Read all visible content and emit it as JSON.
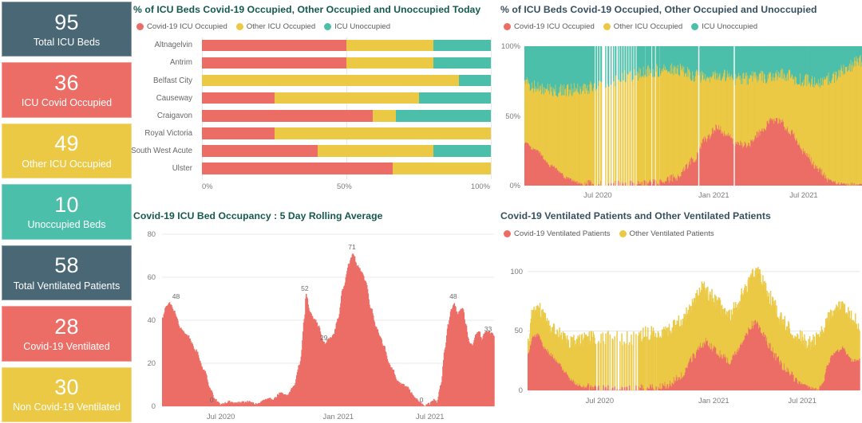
{
  "colors": {
    "covid_red": "#ec6d66",
    "other_yellow": "#ebc945",
    "unoccupied_teal": "#4cbfaa",
    "slate": "#4a6775",
    "title_green": "#14594f",
    "title_slate": "#36505e",
    "axis_text": "#7a7a7a",
    "grid": "#e8e8e8"
  },
  "kpis": [
    {
      "value": "95",
      "label": "Total ICU Beds",
      "color": "#4a6775",
      "name": "total-icu-beds"
    },
    {
      "value": "36",
      "label": "ICU Covid Occupied",
      "color": "#ec6d66",
      "name": "icu-covid-occupied"
    },
    {
      "value": "49",
      "label": "Other ICU Occupied",
      "color": "#ebc945",
      "name": "other-icu-occupied"
    },
    {
      "value": "10",
      "label": "Unoccupied Beds",
      "color": "#4cbfaa",
      "name": "unoccupied-beds"
    },
    {
      "value": "58",
      "label": "Total Ventilated Patients",
      "color": "#4a6775",
      "name": "total-ventilated-patients"
    },
    {
      "value": "28",
      "label": "Covid-19 Ventilated",
      "color": "#ec6d66",
      "name": "covid-19-ventilated"
    },
    {
      "value": "30",
      "label": "Non Covid-19 Ventilated",
      "color": "#ebc945",
      "name": "non-covid-19-ventilated"
    }
  ],
  "panel_top_left": {
    "title": "% of ICU Beds Covid-19 Occupied, Other Occupied and Unoccupied Today",
    "legend": [
      {
        "label": "Covid-19 ICU Occupied",
        "color": "#ec6d66"
      },
      {
        "label": "Other ICU Occupied",
        "color": "#ebc945"
      },
      {
        "label": "ICU Unoccupied",
        "color": "#4cbfaa"
      }
    ],
    "x_ticks": [
      "0%",
      "50%",
      "100%"
    ]
  },
  "panel_top_right": {
    "title": "% of ICU Beds Covid-19 Occupied, Other Occupied and Unoccupied",
    "legend": [
      {
        "label": "Covid-19 ICU Occupied",
        "color": "#ec6d66"
      },
      {
        "label": "Other ICU Occupied",
        "color": "#ebc945"
      },
      {
        "label": "ICU Unoccupied",
        "color": "#4cbfaa"
      }
    ],
    "y_ticks": [
      "100%",
      "50%",
      "0%"
    ],
    "x_ticks": [
      "Jul 2020",
      "Jan 2021",
      "Jul 2021"
    ]
  },
  "panel_bottom_left": {
    "title": "Covid-19 ICU Bed Occupancy : 5 Day Rolling Average",
    "y_ticks": [
      "80",
      "60",
      "40",
      "20",
      "0"
    ],
    "x_ticks": [
      "Jul 2020",
      "Jan 2021",
      "Jul 2021"
    ],
    "point_labels": [
      "48",
      "0",
      "52",
      "29",
      "71",
      "0",
      "48",
      "33"
    ]
  },
  "panel_bottom_right": {
    "title": "Covid-19 Ventilated Patients and Other Ventilated Patients",
    "legend": [
      {
        "label": "Covid-19 Ventilated Patients",
        "color": "#ec6d66"
      },
      {
        "label": "Other Ventilated Patients",
        "color": "#ebc945"
      }
    ],
    "y_ticks": [
      "100",
      "50",
      "0"
    ],
    "x_ticks": [
      "Jul 2020",
      "Jan 2021",
      "Jul 2021"
    ]
  },
  "chart_data": [
    {
      "id": "icu_beds_today_stacked_bar",
      "type": "bar",
      "orientation": "horizontal",
      "stacked": true,
      "normalized_percent": true,
      "title": "% of ICU Beds Covid-19 Occupied, Other Occupied and Unoccupied Today",
      "xlabel": "",
      "ylabel": "",
      "xlim": [
        0,
        100
      ],
      "x_ticks": [
        0,
        50,
        100
      ],
      "grid": true,
      "legend_position": "top-left",
      "categories": [
        "Altnagelvin",
        "Antrim",
        "Belfast City",
        "Causeway",
        "Craigavon",
        "Royal Victoria",
        "South West Acute",
        "Ulster"
      ],
      "series": [
        {
          "name": "Covid-19 ICU Occupied",
          "color": "#ec6d66",
          "values": [
            50,
            50,
            0,
            25,
            59,
            25,
            40,
            66
          ]
        },
        {
          "name": "Other ICU Occupied",
          "color": "#ebc945",
          "values": [
            30,
            30,
            89,
            50,
            8,
            75,
            40,
            34
          ]
        },
        {
          "name": "ICU Unoccupied",
          "color": "#4cbfaa",
          "values": [
            20,
            20,
            11,
            25,
            33,
            0,
            20,
            0
          ]
        }
      ]
    },
    {
      "id": "icu_beds_percent_timeseries",
      "type": "area",
      "stacked": true,
      "normalized_percent": true,
      "title": "% of ICU Beds Covid-19 Occupied, Other Occupied and Unoccupied",
      "xlabel": "",
      "ylabel": "%",
      "ylim": [
        0,
        100
      ],
      "y_ticks": [
        0,
        50,
        100
      ],
      "x_ticks": [
        "Jul 2020",
        "Jan 2021",
        "Jul 2021"
      ],
      "grid": false,
      "legend_position": "top-left",
      "series": [
        {
          "name": "Covid-19 ICU Occupied",
          "color": "#ec6d66"
        },
        {
          "name": "Other ICU Occupied",
          "color": "#ebc945"
        },
        {
          "name": "ICU Unoccupied",
          "color": "#4cbfaa"
        }
      ],
      "notes": "Daily stacked percentage from approx Apr 2020 to late 2021. Covid share starts ~30%, falls to ~0 through summer 2020, rises to ~44% Nov 2020, dips to ~28%, peaks ~48% Jan 2021, falls to ~0 by Jun 2021, rises again to ~45% Sep 2021, ends ~35%."
    },
    {
      "id": "covid_icu_occupancy_rolling",
      "type": "area",
      "title": "Covid-19 ICU Bed Occupancy : 5 Day Rolling Average",
      "xlabel": "",
      "ylabel": "",
      "ylim": [
        0,
        80
      ],
      "y_ticks": [
        0,
        20,
        40,
        60,
        80
      ],
      "x_ticks": [
        "Jul 2020",
        "Jan 2021",
        "Jul 2021"
      ],
      "grid": true,
      "color": "#ec6d66",
      "annotations": [
        {
          "label": "48",
          "value": 48,
          "x_frac": 0.045
        },
        {
          "label": "0",
          "value": 0,
          "x_frac": 0.158
        },
        {
          "label": "52",
          "value": 52,
          "x_frac": 0.433
        },
        {
          "label": "29",
          "value": 29,
          "x_frac": 0.49
        },
        {
          "label": "71",
          "value": 71,
          "x_frac": 0.575
        },
        {
          "label": "0",
          "value": 0,
          "x_frac": 0.79
        },
        {
          "label": "48",
          "value": 48,
          "x_frac": 0.88
        },
        {
          "label": "33",
          "value": 33,
          "x_frac": 0.985
        }
      ],
      "notes": "Single red area series. Starts ~47 falling to 0 by Jul 2020, local max 52 Nov 2020, dip 29, peak 71 Jan 2021, down to 0 by Jul 2021, rises to 48 Sep 2021, ends at 33."
    },
    {
      "id": "ventilated_patients_stacked",
      "type": "area",
      "stacked": true,
      "title": "Covid-19 Ventilated Patients and Other Ventilated Patients",
      "xlabel": "",
      "ylabel": "",
      "ylim": [
        0,
        110
      ],
      "y_ticks": [
        0,
        50,
        100
      ],
      "x_ticks": [
        "Jul 2020",
        "Jan 2021",
        "Jul 2021"
      ],
      "grid": true,
      "legend_position": "top-left",
      "series": [
        {
          "name": "Covid-19 Ventilated Patients",
          "color": "#ec6d66"
        },
        {
          "name": "Other Ventilated Patients",
          "color": "#ebc945"
        }
      ],
      "notes": "Daily stacked counts. Total peaks ~73 in Apr 2020, ~89 Nov 2020, ~104 Jan 2021, ~75 Sep 2021. Covid component peaks ~47 Apr 2020, ~42 Nov 2020, ~57 Jan 2021, ~38 Sep 2021."
    }
  ]
}
